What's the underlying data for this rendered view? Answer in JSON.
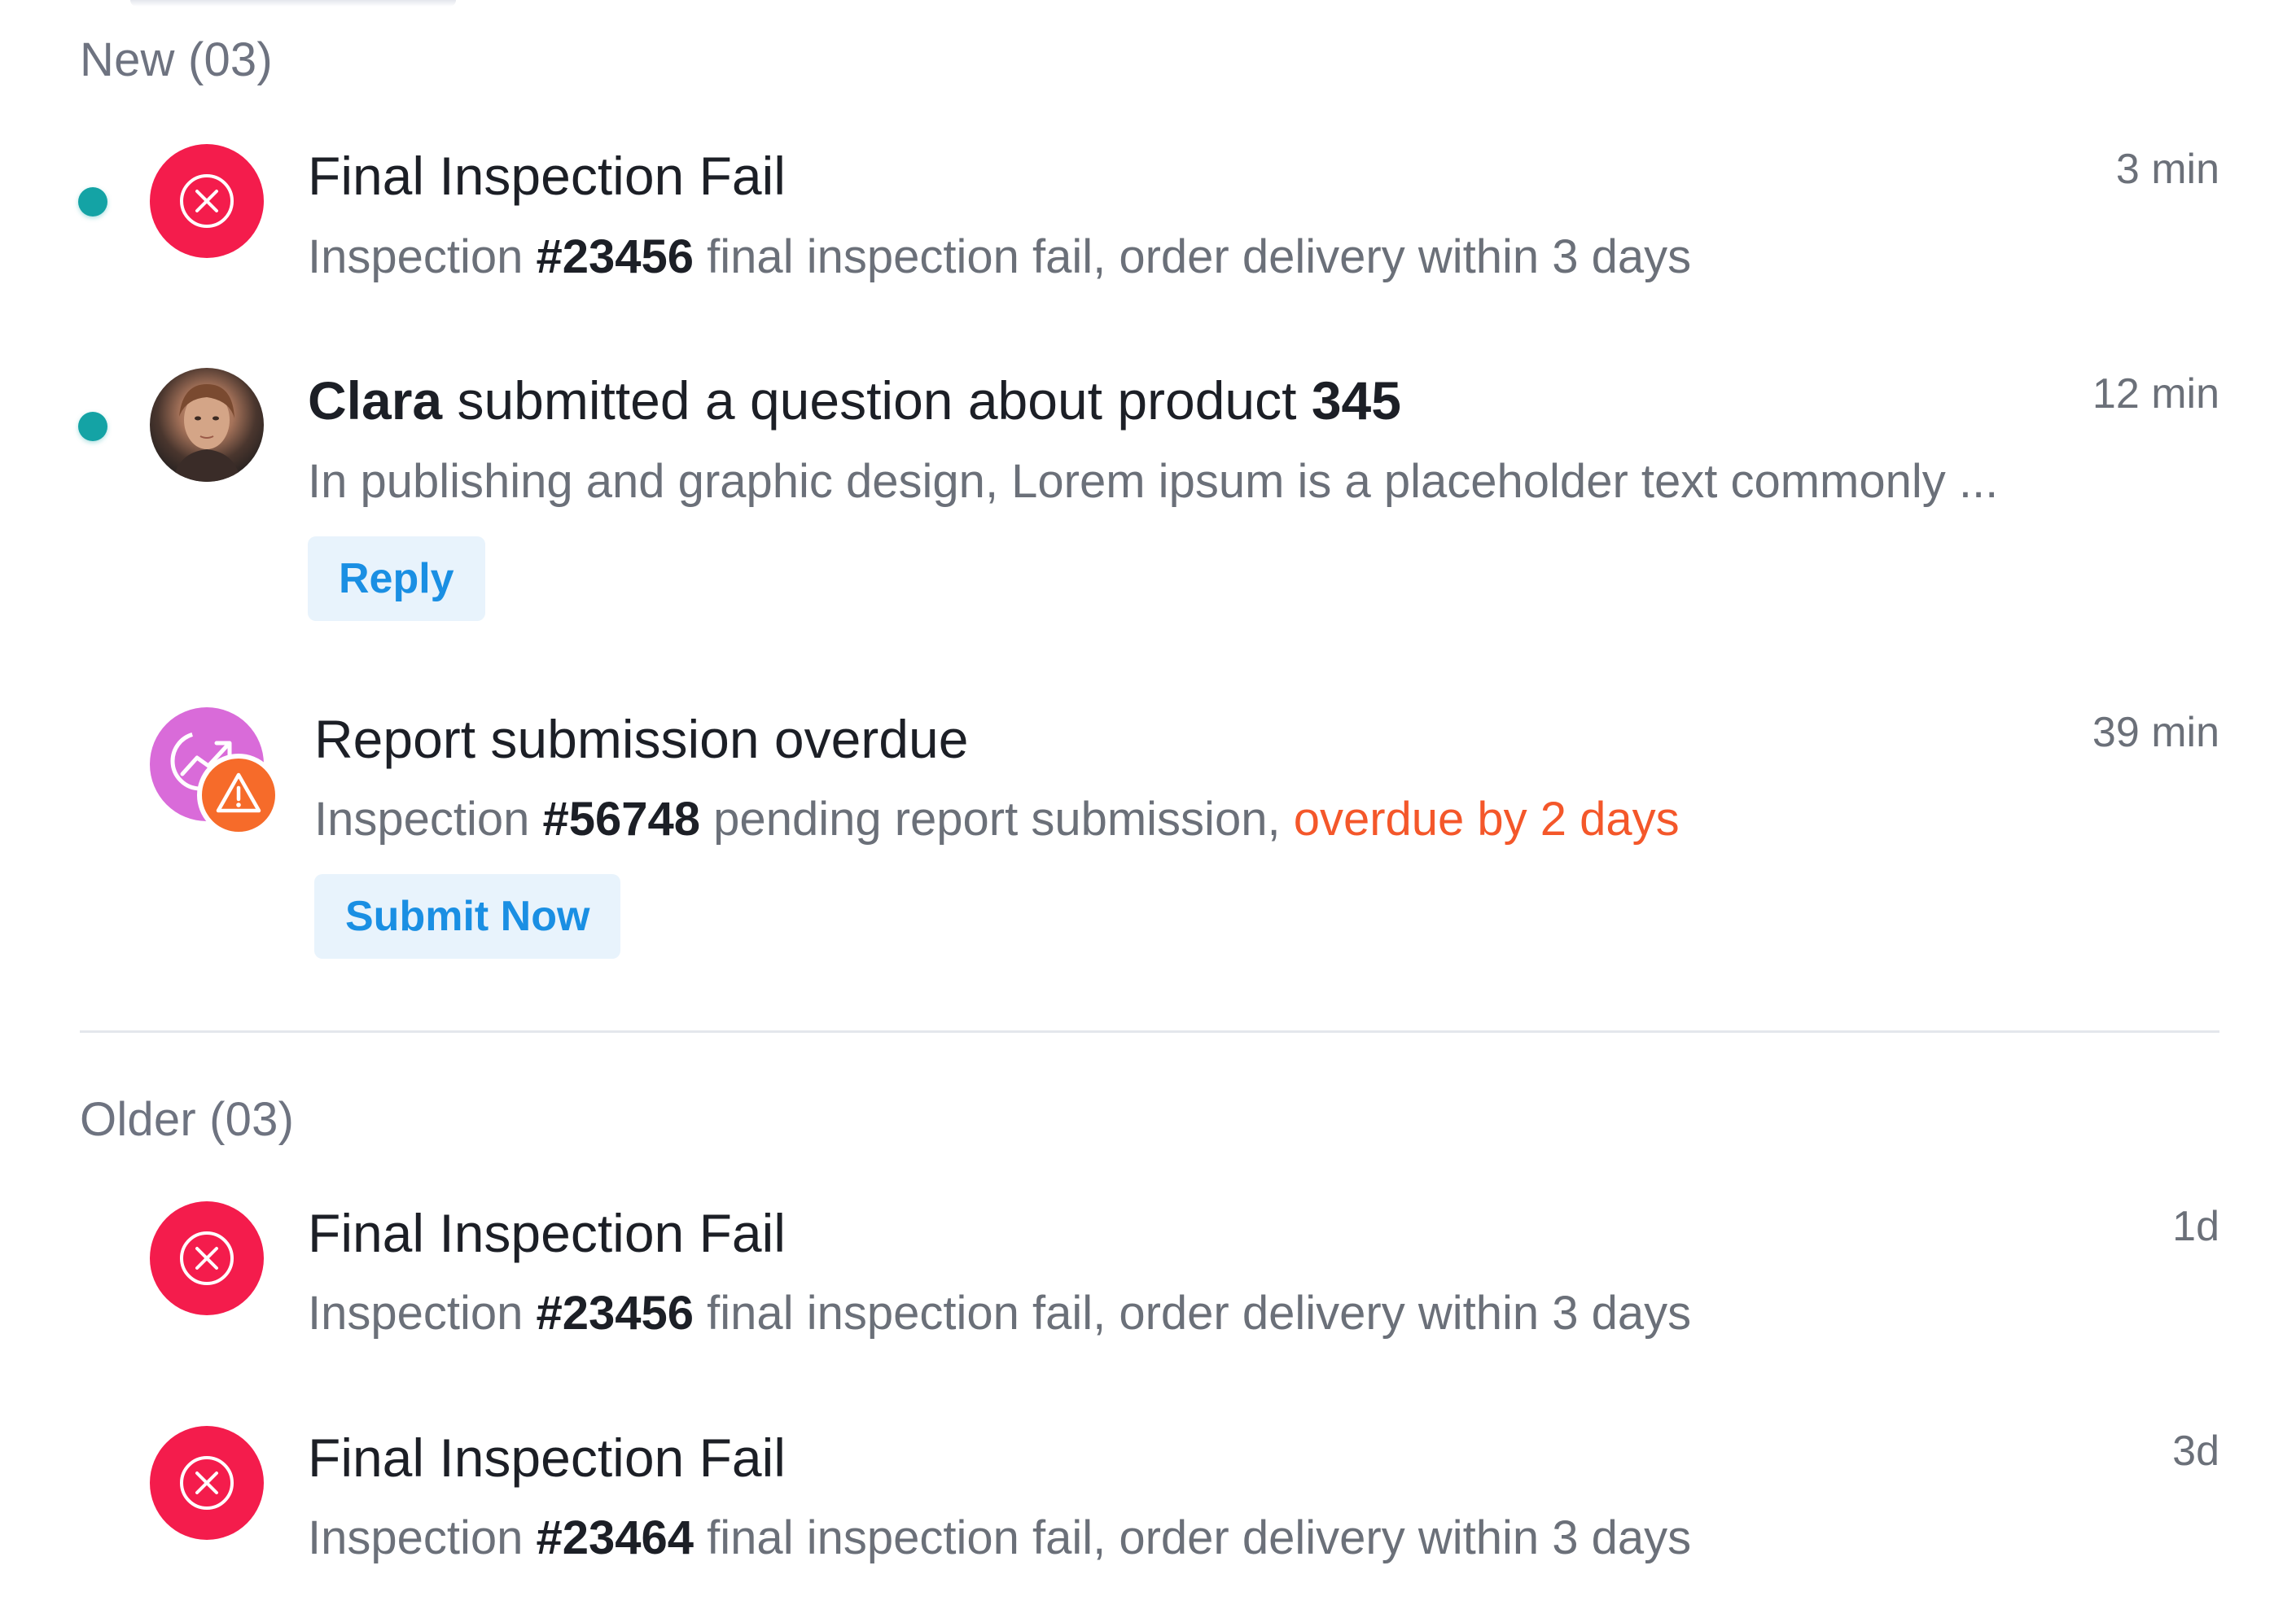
{
  "sections": {
    "new_label": "New (03)",
    "older_label": "Older (03)"
  },
  "new_items": [
    {
      "title": "Final Inspection Fail",
      "desc_prefix": "Inspection ",
      "desc_id": "#23456",
      "desc_suffix": " final inspection fail, order delivery within 3 days",
      "time": "3 min",
      "icon": "close-circle-icon",
      "unread": true
    },
    {
      "title_name": "Clara",
      "title_middle": " submitted a question about product ",
      "title_product": "345",
      "desc": "In publishing and graphic design, Lorem ipsum is a placeholder text commonly ...",
      "time": "12 min",
      "icon": "avatar",
      "unread": true,
      "action": "Reply"
    },
    {
      "title": "Report submission overdue",
      "desc_prefix": "Inspection ",
      "desc_id": "#56748",
      "desc_middle": " pending report submission, ",
      "desc_warning": "overdue by 2 days",
      "time": "39 min",
      "icon": "report-warning-icon",
      "unread": false,
      "action": "Submit Now"
    }
  ],
  "older_items": [
    {
      "title": "Final Inspection Fail",
      "desc_prefix": "Inspection ",
      "desc_id": "#23456",
      "desc_suffix": " final inspection fail, order delivery within 3 days",
      "time": "1d",
      "icon": "close-circle-icon"
    },
    {
      "title": "Final Inspection Fail",
      "desc_prefix": "Inspection ",
      "desc_id": "#23464",
      "desc_suffix": " final inspection fail, order delivery within 3 days",
      "time": "3d",
      "icon": "close-circle-icon"
    }
  ],
  "colors": {
    "unread_dot": "#14a3a5",
    "error_icon": "#f41c4c",
    "report_icon": "#d96bd9",
    "warning_badge": "#f66b2a",
    "warning_text": "#f4572a",
    "button_bg": "#e8f3fc",
    "button_text": "#1a8fe3"
  }
}
